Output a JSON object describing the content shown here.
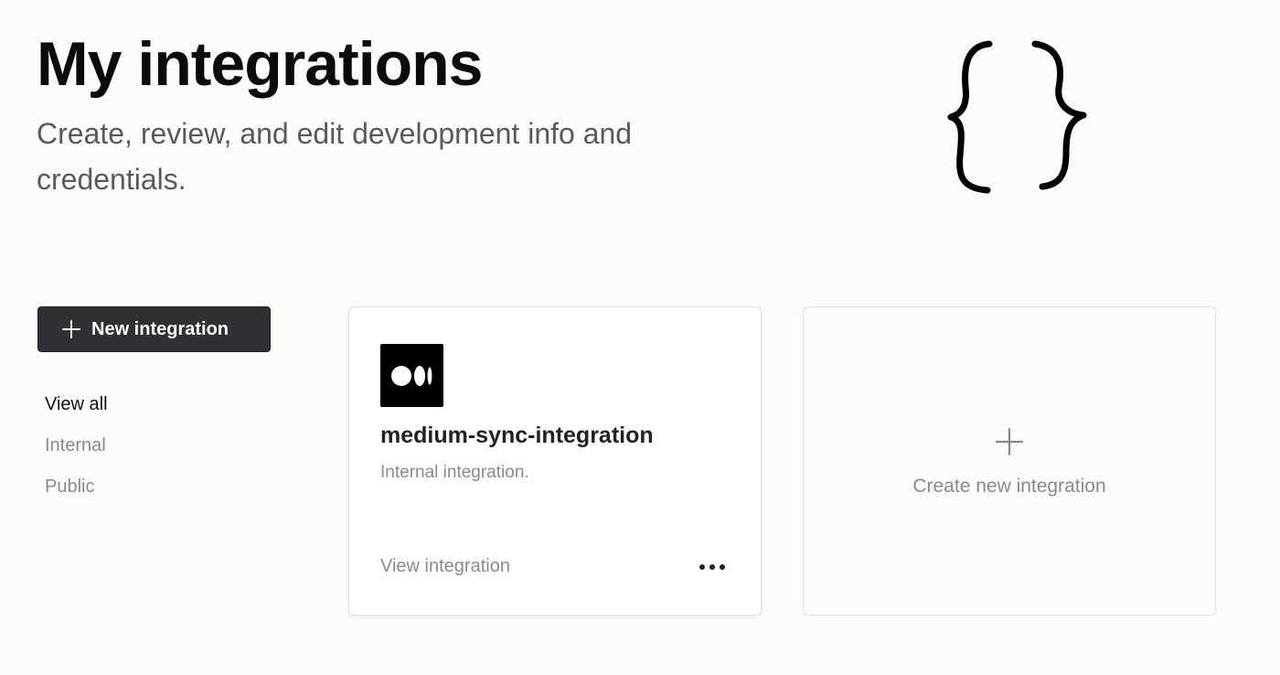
{
  "header": {
    "title": "My integrations",
    "subtitle": "Create, review, and edit development info and credentials."
  },
  "illustration": {
    "icon": "curly-braces-icon"
  },
  "sidebar": {
    "new_button_label": "New integration",
    "new_button_icon": "plus-icon",
    "filters": [
      {
        "label": "View all",
        "active": true
      },
      {
        "label": "Internal",
        "active": false
      },
      {
        "label": "Public",
        "active": false
      }
    ]
  },
  "integrations": [
    {
      "name": "medium-sync-integration",
      "type": "Internal integration.",
      "link_label": "View integration",
      "logo_icon": "medium-logo-icon",
      "menu_icon": "more-horizontal-icon"
    }
  ],
  "create_card": {
    "label": "Create new integration",
    "icon": "plus-icon"
  },
  "colors": {
    "background": "#fdfcfb",
    "primary_button": "#2f3135",
    "muted_text": "#8a8a8a"
  }
}
